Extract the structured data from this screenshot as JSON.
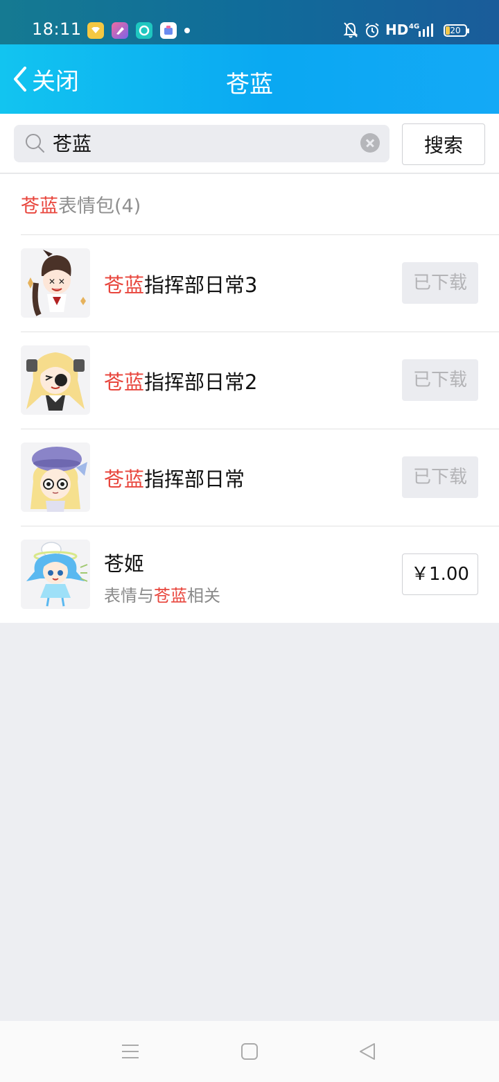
{
  "status_bar": {
    "time": "18:11",
    "network": "HD",
    "signal": "4G",
    "battery": "20",
    "icons": [
      "notification-off-icon",
      "alarm-icon",
      "signal-icon",
      "battery-icon"
    ],
    "app_icons": [
      "app-yellow-icon",
      "app-pink-icon",
      "app-teal-icon",
      "app-white-icon"
    ]
  },
  "nav": {
    "back_label": "关闭",
    "title": "苍蓝"
  },
  "search": {
    "query": "苍蓝",
    "placeholder": "",
    "button_label": "搜索"
  },
  "section": {
    "highlight": "苍蓝",
    "label": "表情包(4)"
  },
  "results": [
    {
      "highlight": "苍蓝",
      "rest": "指挥部日常3",
      "action": "已下载",
      "state": "downloaded"
    },
    {
      "highlight": "苍蓝",
      "rest": "指挥部日常2",
      "action": "已下载",
      "state": "downloaded"
    },
    {
      "highlight": "苍蓝",
      "rest": "指挥部日常",
      "action": "已下载",
      "state": "downloaded"
    },
    {
      "highlight": "",
      "rest": "苍姬",
      "sub_prefix": "表情与",
      "sub_highlight": "苍蓝",
      "sub_suffix": "相关",
      "action": "￥1.00",
      "state": "price"
    }
  ],
  "colors": {
    "highlight": "#e8453c",
    "header": "#0ab5f5",
    "background": "#edeef2"
  }
}
